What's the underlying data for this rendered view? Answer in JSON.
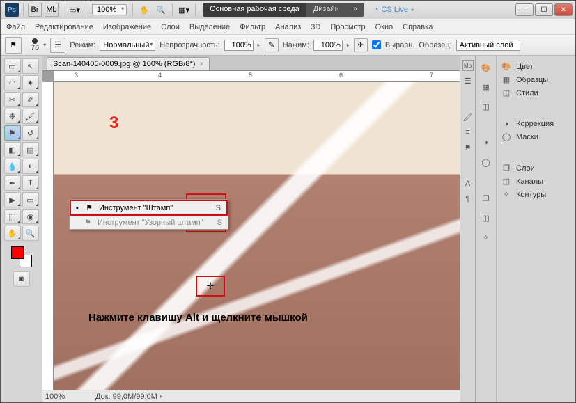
{
  "titlebar": {
    "ps_label": "Ps",
    "br_label": "Br",
    "mb_label": "Mb",
    "zoom": "100%",
    "workspace_active": "Основная рабочая среда",
    "workspace_other": "Дизайн",
    "cslive": "CS Live"
  },
  "menu": [
    "Файл",
    "Редактирование",
    "Изображение",
    "Слои",
    "Выделение",
    "Фильтр",
    "Анализ",
    "3D",
    "Просмотр",
    "Окно",
    "Справка"
  ],
  "options": {
    "brush_size": "76",
    "mode_label": "Режим:",
    "mode_value": "Нормальный",
    "opacity_label": "Непрозрачность:",
    "opacity_value": "100%",
    "flow_label": "Нажим:",
    "flow_value": "100%",
    "aligned_label": "Выравн.",
    "sample_label": "Образец:",
    "sample_value": "Активный слой"
  },
  "doc": {
    "tab_title": "Scan-140405-0009.jpg @ 100% (RGB/8*)",
    "ruler_marks": [
      "3",
      "4",
      "5",
      "6",
      "7"
    ],
    "status_zoom": "100%",
    "status_doc": "Док: 99,0M/99,0M"
  },
  "flyout": {
    "item1": "Инструмент \"Штамп\"",
    "item2": "Инструмент \"Узорный штамп\"",
    "key": "S"
  },
  "annot": {
    "num": "3",
    "cross": "✛",
    "text": "Нажмите клавишу Alt и щелкните мышкой"
  },
  "panels": {
    "color": "Цвет",
    "swatches": "Образцы",
    "styles": "Стили",
    "adjust": "Коррекция",
    "masks": "Маски",
    "layers": "Слои",
    "channels": "Каналы",
    "paths": "Контуры"
  }
}
